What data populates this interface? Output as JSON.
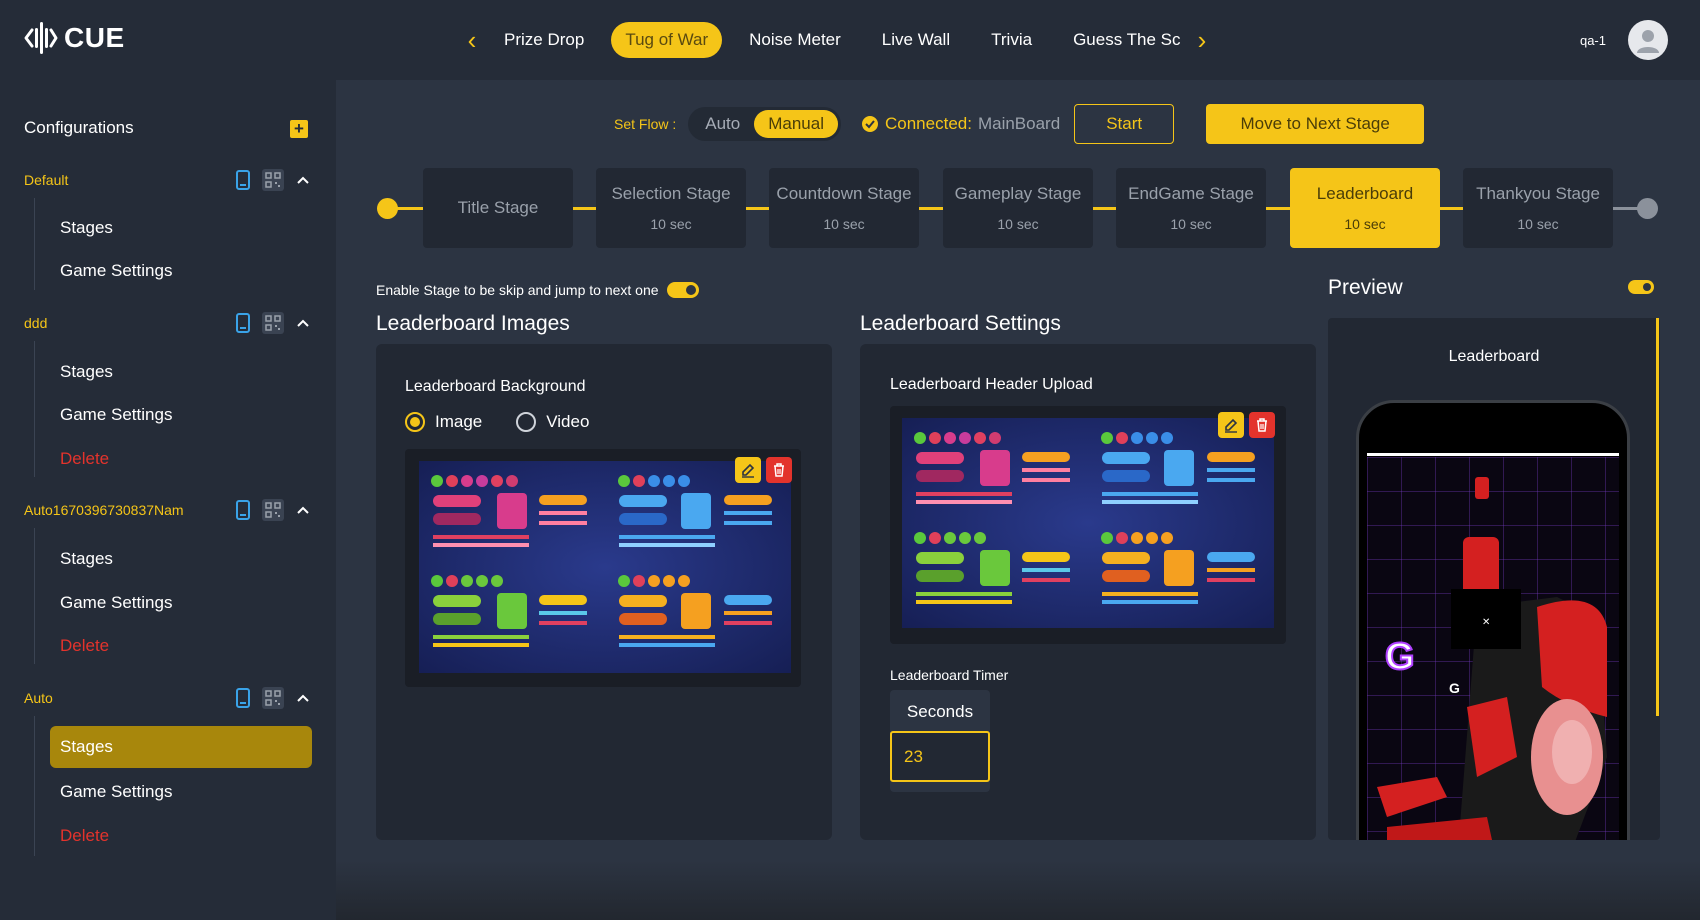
{
  "app": {
    "brand": "CUE",
    "user": "qa-1"
  },
  "nav": {
    "tabs": [
      {
        "label": "Prize Drop",
        "active": false
      },
      {
        "label": "Tug of War",
        "active": true
      },
      {
        "label": "Noise Meter",
        "active": false
      },
      {
        "label": "Live Wall",
        "active": false
      },
      {
        "label": "Trivia",
        "active": false
      },
      {
        "label": "Guess The Sc",
        "active": false
      }
    ]
  },
  "sidebar": {
    "title": "Configurations",
    "configs": [
      {
        "name": "Default",
        "items": [
          "Stages",
          "Game Settings"
        ]
      },
      {
        "name": "ddd",
        "items": [
          "Stages",
          "Game Settings",
          "Delete"
        ]
      },
      {
        "name": "Auto1670396730837Nam",
        "items": [
          "Stages",
          "Game Settings",
          "Delete"
        ]
      },
      {
        "name": "Auto",
        "items": [
          "Stages",
          "Game Settings",
          "Delete"
        ],
        "active_item": "Stages"
      }
    ]
  },
  "flow": {
    "label": "Set Flow :",
    "options": [
      "Auto",
      "Manual"
    ],
    "selected": "Manual",
    "connected_label": "Connected:",
    "connected_value": "MainBoard",
    "start_label": "Start",
    "next_stage_label": "Move to Next Stage"
  },
  "stages": [
    {
      "name": "Title Stage",
      "time": ""
    },
    {
      "name": "Selection Stage",
      "time": "10 sec"
    },
    {
      "name": "Countdown Stage",
      "time": "10 sec"
    },
    {
      "name": "Gameplay Stage",
      "time": "10 sec"
    },
    {
      "name": "EndGame Stage",
      "time": "10 sec"
    },
    {
      "name": "Leaderboard",
      "time": "10 sec",
      "active": true
    },
    {
      "name": "Thankyou Stage",
      "time": "10 sec"
    }
  ],
  "skip": {
    "label": "Enable Stage to be skip and jump to next one",
    "enabled": true
  },
  "images": {
    "title": "Leaderboard Images",
    "background_label": "Leaderboard Background",
    "media_options": [
      "Image",
      "Video"
    ],
    "media_selected": "Image"
  },
  "settings": {
    "title": "Leaderboard Settings",
    "header_upload_label": "Leaderboard Header Upload",
    "timer_label": "Leaderboard Timer",
    "seconds_label": "Seconds",
    "seconds_value": "23"
  },
  "preview": {
    "title": "Preview",
    "enabled": true,
    "screen_title": "Leaderboard"
  },
  "colors": {
    "accent": "#f5c518",
    "background": "#2c3442",
    "panel": "#222833",
    "danger": "#e3332c"
  }
}
